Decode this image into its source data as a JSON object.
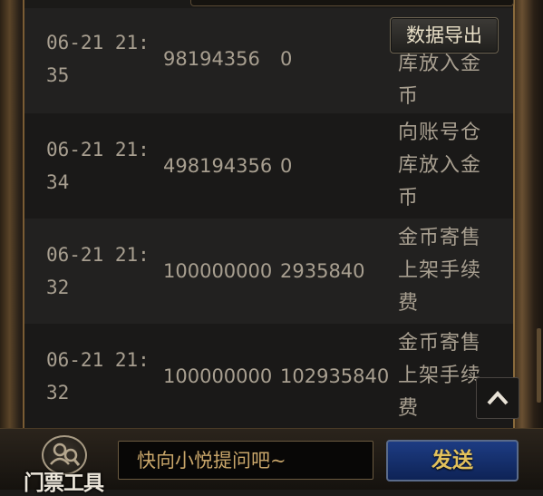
{
  "toolbar": {
    "export_label": "数据导出"
  },
  "records": [
    {
      "time_line1": "06-21 21:",
      "time_line2": "35",
      "amount": "98194356",
      "balance": "0",
      "desc_lines": [
        "库放入金",
        "币"
      ]
    },
    {
      "time_line1": "06-21 21:",
      "time_line2": "34",
      "amount": "498194356",
      "balance": "0",
      "desc_lines": [
        "向账号仓",
        "库放入金",
        "币"
      ]
    },
    {
      "time_line1": "06-21 21:",
      "time_line2": "32",
      "amount": "100000000",
      "balance": "2935840",
      "desc_lines": [
        "金币寄售",
        "上架手续",
        "费"
      ]
    },
    {
      "time_line1": "06-21 21:",
      "time_line2": "32",
      "amount": "100000000",
      "balance": "102935840",
      "desc_lines": [
        "金币寄售",
        "上架手续",
        "费"
      ]
    }
  ],
  "bottom": {
    "ticket_tool_label": "门票工具",
    "chat_placeholder": "快向小悦提问吧~",
    "send_label": "发送"
  },
  "icons": {
    "back_to_top": "chevron-up-icon",
    "ticket_tool": "ticket-tool-icon"
  },
  "colors": {
    "text": "#a89f90",
    "send_button": "#1d3c83",
    "send_text": "#e2c15c",
    "frame_gold": "#7a5c34"
  }
}
